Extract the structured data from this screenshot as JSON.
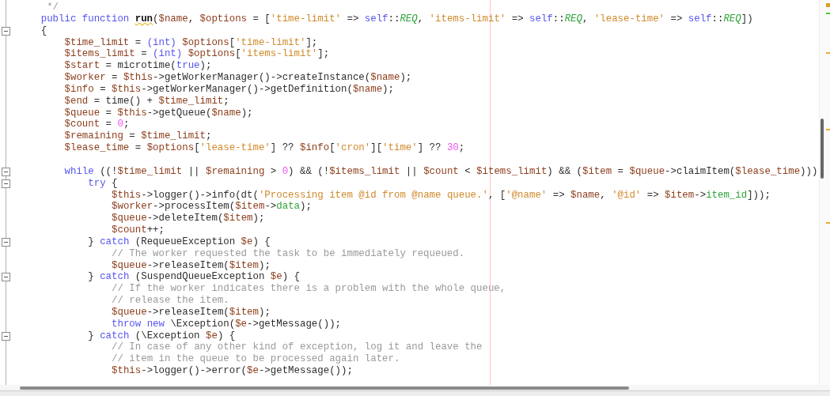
{
  "editor": {
    "lines": [
      {
        "fold": false,
        "tokens": [
          {
            "text": " */",
            "kind": "comment"
          }
        ]
      },
      {
        "fold": false,
        "tokens": [
          {
            "text": "public function ",
            "kind": "keyword"
          },
          {
            "text": "run",
            "kind": "definition"
          },
          {
            "text": "(",
            "kind": "plain"
          },
          {
            "text": "$name",
            "kind": "variable"
          },
          {
            "text": ", ",
            "kind": "plain"
          },
          {
            "text": "$options",
            "kind": "variable"
          },
          {
            "text": " = [",
            "kind": "plain"
          },
          {
            "text": "'time-limit'",
            "kind": "string"
          },
          {
            "text": " => ",
            "kind": "plain"
          },
          {
            "text": "self",
            "kind": "keyword"
          },
          {
            "text": "::",
            "kind": "plain"
          },
          {
            "text": "REQ",
            "kind": "constant"
          },
          {
            "text": ", ",
            "kind": "plain"
          },
          {
            "text": "'items-limit'",
            "kind": "string"
          },
          {
            "text": " => ",
            "kind": "plain"
          },
          {
            "text": "self",
            "kind": "keyword"
          },
          {
            "text": "::",
            "kind": "plain"
          },
          {
            "text": "REQ",
            "kind": "constant"
          },
          {
            "text": ", ",
            "kind": "plain"
          },
          {
            "text": "'lease-time'",
            "kind": "string"
          },
          {
            "text": " => ",
            "kind": "plain"
          },
          {
            "text": "self",
            "kind": "keyword"
          },
          {
            "text": "::",
            "kind": "plain"
          },
          {
            "text": "REQ",
            "kind": "constant"
          },
          {
            "text": "])",
            "kind": "plain"
          }
        ]
      },
      {
        "fold": true,
        "tokens": [
          {
            "text": "{",
            "kind": "plain"
          }
        ],
        "children": [
          {
            "fold": false,
            "tokens": [
              {
                "text": "$time_limit",
                "kind": "variable"
              },
              {
                "text": " = ",
                "kind": "plain"
              },
              {
                "text": "(int)",
                "kind": "keyword"
              },
              {
                "text": " $options",
                "kind": "variable"
              },
              {
                "text": "[",
                "kind": "plain"
              },
              {
                "text": "'time-limit'",
                "kind": "string"
              },
              {
                "text": "];",
                "kind": "plain"
              }
            ]
          },
          {
            "fold": false,
            "tokens": [
              {
                "text": "$items_limit",
                "kind": "variable"
              },
              {
                "text": " = ",
                "kind": "plain"
              },
              {
                "text": "(int)",
                "kind": "keyword"
              },
              {
                "text": " $options",
                "kind": "variable"
              },
              {
                "text": "[",
                "kind": "plain"
              },
              {
                "text": "'items-limit'",
                "kind": "string"
              },
              {
                "text": "];",
                "kind": "plain"
              }
            ]
          },
          {
            "fold": false,
            "tokens": [
              {
                "text": "$start",
                "kind": "variable"
              },
              {
                "text": " = microtime(",
                "kind": "plain"
              },
              {
                "text": "true",
                "kind": "keyword"
              },
              {
                "text": ");",
                "kind": "plain"
              }
            ]
          },
          {
            "fold": false,
            "tokens": [
              {
                "text": "$worker",
                "kind": "variable"
              },
              {
                "text": " = ",
                "kind": "plain"
              },
              {
                "text": "$this",
                "kind": "variable"
              },
              {
                "text": "->getWorkerManager()->createInstance(",
                "kind": "plain"
              },
              {
                "text": "$name",
                "kind": "variable"
              },
              {
                "text": ");",
                "kind": "plain"
              }
            ]
          },
          {
            "fold": false,
            "tokens": [
              {
                "text": "$info",
                "kind": "variable"
              },
              {
                "text": " = ",
                "kind": "plain"
              },
              {
                "text": "$this",
                "kind": "variable"
              },
              {
                "text": "->getWorkerManager()->getDefinition(",
                "kind": "plain"
              },
              {
                "text": "$name",
                "kind": "variable"
              },
              {
                "text": ");",
                "kind": "plain"
              }
            ]
          },
          {
            "fold": false,
            "tokens": [
              {
                "text": "$end",
                "kind": "variable"
              },
              {
                "text": " = time() + ",
                "kind": "plain"
              },
              {
                "text": "$time_limit",
                "kind": "variable"
              },
              {
                "text": ";",
                "kind": "plain"
              }
            ]
          },
          {
            "fold": false,
            "tokens": [
              {
                "text": "$queue",
                "kind": "variable"
              },
              {
                "text": " = ",
                "kind": "plain"
              },
              {
                "text": "$this",
                "kind": "variable"
              },
              {
                "text": "->getQueue(",
                "kind": "plain"
              },
              {
                "text": "$name",
                "kind": "variable"
              },
              {
                "text": ");",
                "kind": "plain"
              }
            ]
          },
          {
            "fold": false,
            "tokens": [
              {
                "text": "$count",
                "kind": "variable"
              },
              {
                "text": " = ",
                "kind": "plain"
              },
              {
                "text": "0",
                "kind": "number"
              },
              {
                "text": ";",
                "kind": "plain"
              }
            ]
          },
          {
            "fold": false,
            "tokens": [
              {
                "text": "$remaining",
                "kind": "variable"
              },
              {
                "text": " = ",
                "kind": "plain"
              },
              {
                "text": "$time_limit",
                "kind": "variable"
              },
              {
                "text": ";",
                "kind": "plain"
              }
            ]
          },
          {
            "fold": false,
            "tokens": [
              {
                "text": "$lease_time",
                "kind": "variable"
              },
              {
                "text": " = ",
                "kind": "plain"
              },
              {
                "text": "$options",
                "kind": "variable"
              },
              {
                "text": "[",
                "kind": "plain"
              },
              {
                "text": "'lease-time'",
                "kind": "string"
              },
              {
                "text": "] ?? ",
                "kind": "plain"
              },
              {
                "text": "$info",
                "kind": "variable"
              },
              {
                "text": "[",
                "kind": "plain"
              },
              {
                "text": "'cron'",
                "kind": "string"
              },
              {
                "text": "][",
                "kind": "plain"
              },
              {
                "text": "'time'",
                "kind": "string"
              },
              {
                "text": "] ?? ",
                "kind": "plain"
              },
              {
                "text": "30",
                "kind": "number"
              },
              {
                "text": ";",
                "kind": "plain"
              }
            ]
          },
          {
            "fold": false
          },
          {
            "fold": true,
            "tokens": [
              {
                "text": "while",
                "kind": "keyword"
              },
              {
                "text": " ((!",
                "kind": "plain"
              },
              {
                "text": "$time_limit",
                "kind": "variable"
              },
              {
                "text": " || ",
                "kind": "plain"
              },
              {
                "text": "$remaining",
                "kind": "variable"
              },
              {
                "text": " > ",
                "kind": "plain"
              },
              {
                "text": "0",
                "kind": "number"
              },
              {
                "text": ") && (!",
                "kind": "plain"
              },
              {
                "text": "$items_limit",
                "kind": "variable"
              },
              {
                "text": " || ",
                "kind": "plain"
              },
              {
                "text": "$count",
                "kind": "variable"
              },
              {
                "text": " < ",
                "kind": "plain"
              },
              {
                "text": "$items_limit",
                "kind": "variable"
              },
              {
                "text": ") && (",
                "kind": "plain"
              },
              {
                "text": "$item",
                "kind": "variable"
              },
              {
                "text": " = ",
                "kind": "plain"
              },
              {
                "text": "$queue",
                "kind": "variable"
              },
              {
                "text": "->claimItem(",
                "kind": "plain"
              },
              {
                "text": "$lease_time",
                "kind": "variable"
              },
              {
                "text": ")))",
                "kind": "plain"
              }
            ],
            "children": [
              {
                "fold": true,
                "tokens": [
                  {
                    "text": "try",
                    "kind": "keyword"
                  },
                  {
                    "text": " {",
                    "kind": "plain"
                  }
                ],
                "children": [
                  {
                    "fold": false,
                    "tokens": [
                      {
                        "text": "$this",
                        "kind": "variable"
                      },
                      {
                        "text": "->logger()->info(dt(",
                        "kind": "plain"
                      },
                      {
                        "text": "'Processing item @id from @name queue.'",
                        "kind": "string"
                      },
                      {
                        "text": ", [",
                        "kind": "plain"
                      },
                      {
                        "text": "'@name'",
                        "kind": "string"
                      },
                      {
                        "text": " => ",
                        "kind": "plain"
                      },
                      {
                        "text": "$name",
                        "kind": "variable"
                      },
                      {
                        "text": ", ",
                        "kind": "plain"
                      },
                      {
                        "text": "'@id'",
                        "kind": "string"
                      },
                      {
                        "text": " => ",
                        "kind": "plain"
                      },
                      {
                        "text": "$item",
                        "kind": "variable"
                      },
                      {
                        "text": "->",
                        "kind": "plain"
                      },
                      {
                        "text": "item_id",
                        "kind": "property"
                      },
                      {
                        "text": "]));",
                        "kind": "plain"
                      }
                    ]
                  },
                  {
                    "fold": false,
                    "tokens": [
                      {
                        "text": "$worker",
                        "kind": "variable"
                      },
                      {
                        "text": "->processItem(",
                        "kind": "plain"
                      },
                      {
                        "text": "$item",
                        "kind": "variable"
                      },
                      {
                        "text": "->",
                        "kind": "plain"
                      },
                      {
                        "text": "data",
                        "kind": "property"
                      },
                      {
                        "text": ");",
                        "kind": "plain"
                      }
                    ]
                  },
                  {
                    "fold": false,
                    "tokens": [
                      {
                        "text": "$queue",
                        "kind": "variable"
                      },
                      {
                        "text": "->deleteItem(",
                        "kind": "plain"
                      },
                      {
                        "text": "$item",
                        "kind": "variable"
                      },
                      {
                        "text": ");",
                        "kind": "plain"
                      }
                    ]
                  },
                  {
                    "fold": false,
                    "tokens": [
                      {
                        "text": "$count",
                        "kind": "variable"
                      },
                      {
                        "text": "++;",
                        "kind": "plain"
                      }
                    ]
                  }
                ]
              },
              {
                "fold": true,
                "tokens": [
                  {
                    "text": "} ",
                    "kind": "plain"
                  },
                  {
                    "text": "catch",
                    "kind": "keyword"
                  },
                  {
                    "text": " (RequeueException ",
                    "kind": "plain"
                  },
                  {
                    "text": "$e",
                    "kind": "variable"
                  },
                  {
                    "text": ") {",
                    "kind": "plain"
                  }
                ],
                "children": [
                  {
                    "fold": false,
                    "tokens": [
                      {
                        "text": "// The worker requested the task to be immediately requeued.",
                        "kind": "comment"
                      }
                    ]
                  },
                  {
                    "fold": false,
                    "tokens": [
                      {
                        "text": "$queue",
                        "kind": "variable"
                      },
                      {
                        "text": "->releaseItem(",
                        "kind": "plain"
                      },
                      {
                        "text": "$item",
                        "kind": "variable"
                      },
                      {
                        "text": ");",
                        "kind": "plain"
                      }
                    ]
                  }
                ]
              },
              {
                "fold": true,
                "tokens": [
                  {
                    "text": "} ",
                    "kind": "plain"
                  },
                  {
                    "text": "catch",
                    "kind": "keyword"
                  },
                  {
                    "text": " (SuspendQueueException ",
                    "kind": "plain"
                  },
                  {
                    "text": "$e",
                    "kind": "variable"
                  },
                  {
                    "text": ") {",
                    "kind": "plain"
                  }
                ],
                "children": [
                  {
                    "fold": false,
                    "tokens": [
                      {
                        "text": "// If the worker indicates there is a problem with the whole queue,",
                        "kind": "comment"
                      }
                    ]
                  },
                  {
                    "fold": false,
                    "tokens": [
                      {
                        "text": "// release the item.",
                        "kind": "comment"
                      }
                    ]
                  },
                  {
                    "fold": false,
                    "tokens": [
                      {
                        "text": "$queue",
                        "kind": "variable"
                      },
                      {
                        "text": "->releaseItem(",
                        "kind": "plain"
                      },
                      {
                        "text": "$item",
                        "kind": "variable"
                      },
                      {
                        "text": ");",
                        "kind": "plain"
                      }
                    ]
                  },
                  {
                    "fold": false,
                    "tokens": [
                      {
                        "text": "throw new",
                        "kind": "keyword"
                      },
                      {
                        "text": " \\Exception(",
                        "kind": "plain"
                      },
                      {
                        "text": "$e",
                        "kind": "variable"
                      },
                      {
                        "text": "->getMessage());",
                        "kind": "plain"
                      }
                    ]
                  }
                ]
              },
              {
                "fold": true,
                "tokens": [
                  {
                    "text": "} ",
                    "kind": "plain"
                  },
                  {
                    "text": "catch",
                    "kind": "keyword"
                  },
                  {
                    "text": " (\\Exception ",
                    "kind": "plain"
                  },
                  {
                    "text": "$e",
                    "kind": "variable"
                  },
                  {
                    "text": ") {",
                    "kind": "plain"
                  }
                ],
                "children": [
                  {
                    "fold": false,
                    "tokens": [
                      {
                        "text": "// In case of any other kind of exception, log it and leave the",
                        "kind": "comment"
                      }
                    ]
                  },
                  {
                    "fold": false,
                    "tokens": [
                      {
                        "text": "// item in the queue to be processed again later.",
                        "kind": "comment"
                      }
                    ]
                  },
                  {
                    "fold": false,
                    "tokens": [
                      {
                        "text": "$this",
                        "kind": "variable"
                      },
                      {
                        "text": "->logger()->error(",
                        "kind": "plain"
                      },
                      {
                        "text": "$e",
                        "kind": "variable"
                      },
                      {
                        "text": "->getMessage());",
                        "kind": "plain"
                      }
                    ]
                  }
                ]
              }
            ]
          }
        ]
      }
    ]
  }
}
